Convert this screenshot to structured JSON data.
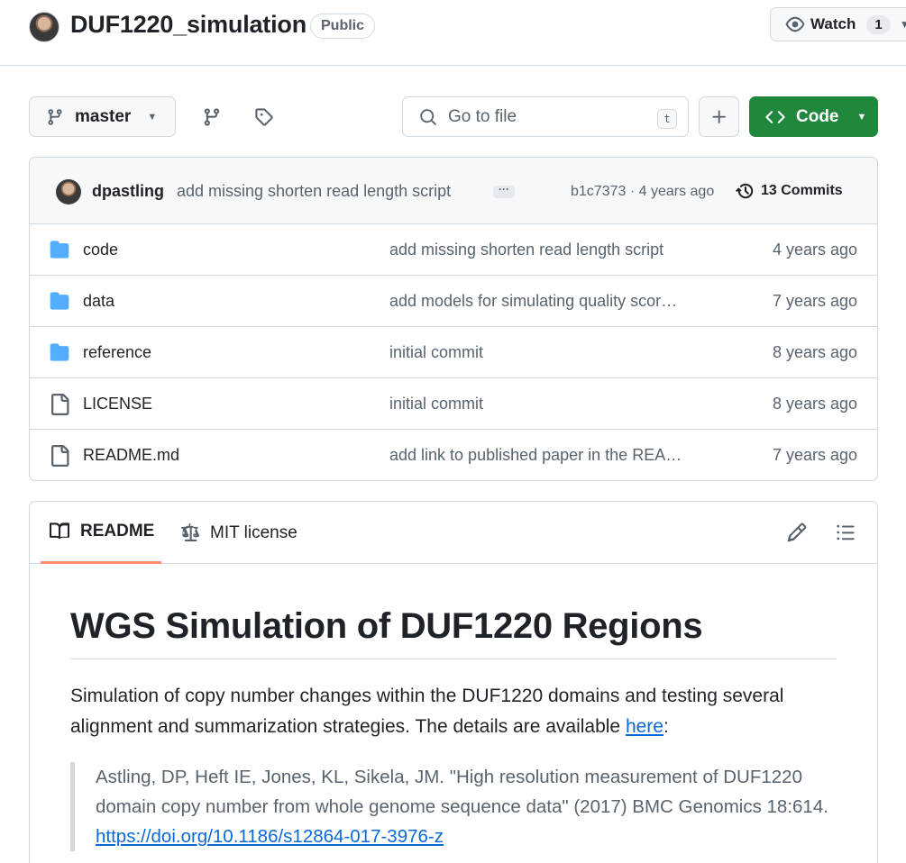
{
  "repo": {
    "name": "DUF1220_simulation",
    "visibility": "Public",
    "watch_label": "Watch",
    "watch_count": "1"
  },
  "toolbar": {
    "branch": "master",
    "goto_placeholder": "Go to file",
    "goto_shortcut": "t",
    "code_label": "Code"
  },
  "latest_commit": {
    "author": "dpastling",
    "message": "add missing shorten read length script",
    "sha_age": "b1c7373 · 4 years ago",
    "commits_label": "13 Commits"
  },
  "files": [
    {
      "name": "code",
      "type": "dir",
      "message": "add missing shorten read length script",
      "age": "4 years ago"
    },
    {
      "name": "data",
      "type": "dir",
      "message": "add models for simulating quality scor…",
      "age": "7 years ago"
    },
    {
      "name": "reference",
      "type": "dir",
      "message": "initial commit",
      "age": "8 years ago"
    },
    {
      "name": "LICENSE",
      "type": "file",
      "message": "initial commit",
      "age": "8 years ago"
    },
    {
      "name": "README.md",
      "type": "file",
      "message": "add link to published paper in the REA…",
      "age": "7 years ago"
    }
  ],
  "readme": {
    "tab_readme": "README",
    "tab_license": "MIT license",
    "title": "WGS Simulation of DUF1220 Regions",
    "para_text": "Simulation of copy number changes within the DUF1220 domains and testing several alignment and summarization strategies. The details are available ",
    "para_link": "here",
    "para_end": ":",
    "quote_text": "Astling, DP, Heft IE, Jones, KL, Sikela, JM. \"High resolution measurement of DUF1220 domain copy number from whole genome sequence data\" (2017) BMC Genomics 18:614. ",
    "quote_link": "https://doi.org/10.1186/s12864-017-3976-z"
  },
  "colors": {
    "folder": "#54aeff",
    "code_button": "#1f883d",
    "active_tab_underline": "#fd8c73",
    "link": "#0969da"
  }
}
